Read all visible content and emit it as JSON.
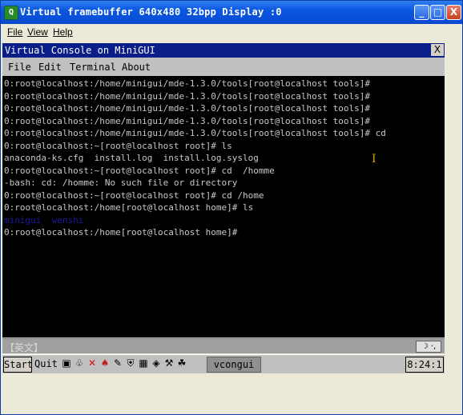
{
  "window": {
    "title": "Virtual framebuffer 640x480 32bpp Display :0",
    "app_icon": "Q",
    "buttons": {
      "minimize": "_",
      "maximize": "□",
      "close": "X"
    }
  },
  "menubar": {
    "file": "File",
    "view": "View",
    "help": "Help"
  },
  "console": {
    "title": "Virtual Console on MiniGUI",
    "close": "X",
    "menu": {
      "file": "File",
      "edit": "Edit",
      "terminal": "Terminal",
      "about": "About"
    },
    "lines": [
      {
        "text": "0:root@localhost:/home/minigui/mde-1.3.0/tools[root@localhost tools]#",
        "color": "#c8c8c8"
      },
      {
        "text": "0:root@localhost:/home/minigui/mde-1.3.0/tools[root@localhost tools]#",
        "color": "#c8c8c8"
      },
      {
        "text": "0:root@localhost:/home/minigui/mde-1.3.0/tools[root@localhost tools]#",
        "color": "#c8c8c8"
      },
      {
        "text": "0:root@localhost:/home/minigui/mde-1.3.0/tools[root@localhost tools]#",
        "color": "#c8c8c8"
      },
      {
        "text": "0:root@localhost:/home/minigui/mde-1.3.0/tools[root@localhost tools]# cd",
        "color": "#c8c8c8"
      },
      {
        "text": "0:root@localhost:~[root@localhost root]# ls",
        "color": "#c8c8c8"
      },
      {
        "text": "anaconda-ks.cfg  install.log  install.log.syslog",
        "color": "#c8c8c8"
      },
      {
        "text": "0:root@localhost:~[root@localhost root]# cd  /homme",
        "color": "#c8c8c8"
      },
      {
        "text": "-bash: cd: /homme: No such file or directory",
        "color": "#c8c8c8"
      },
      {
        "text": "0:root@localhost:~[root@localhost root]# cd /home",
        "color": "#c8c8c8"
      },
      {
        "text": "0:root@localhost:/home[root@localhost home]# ls",
        "color": "#c8c8c8"
      },
      {
        "text": "minigui  wenshi",
        "color": "#1a1aa0"
      },
      {
        "text": "0:root@localhost:/home[root@localhost home]#",
        "color": "#c8c8c8"
      }
    ],
    "cursor_glyph": "I"
  },
  "ime": {
    "label": "【英文】",
    "buttons": "☽ ·,"
  },
  "taskbar": {
    "start": "Start",
    "quit": "Quit",
    "icons": [
      "▣",
      "♧",
      "✕",
      "♠",
      "✎",
      "⛨",
      "▦",
      "◈",
      "⚒",
      "☘"
    ],
    "task": "vcongui",
    "clock": "8:24:1"
  }
}
